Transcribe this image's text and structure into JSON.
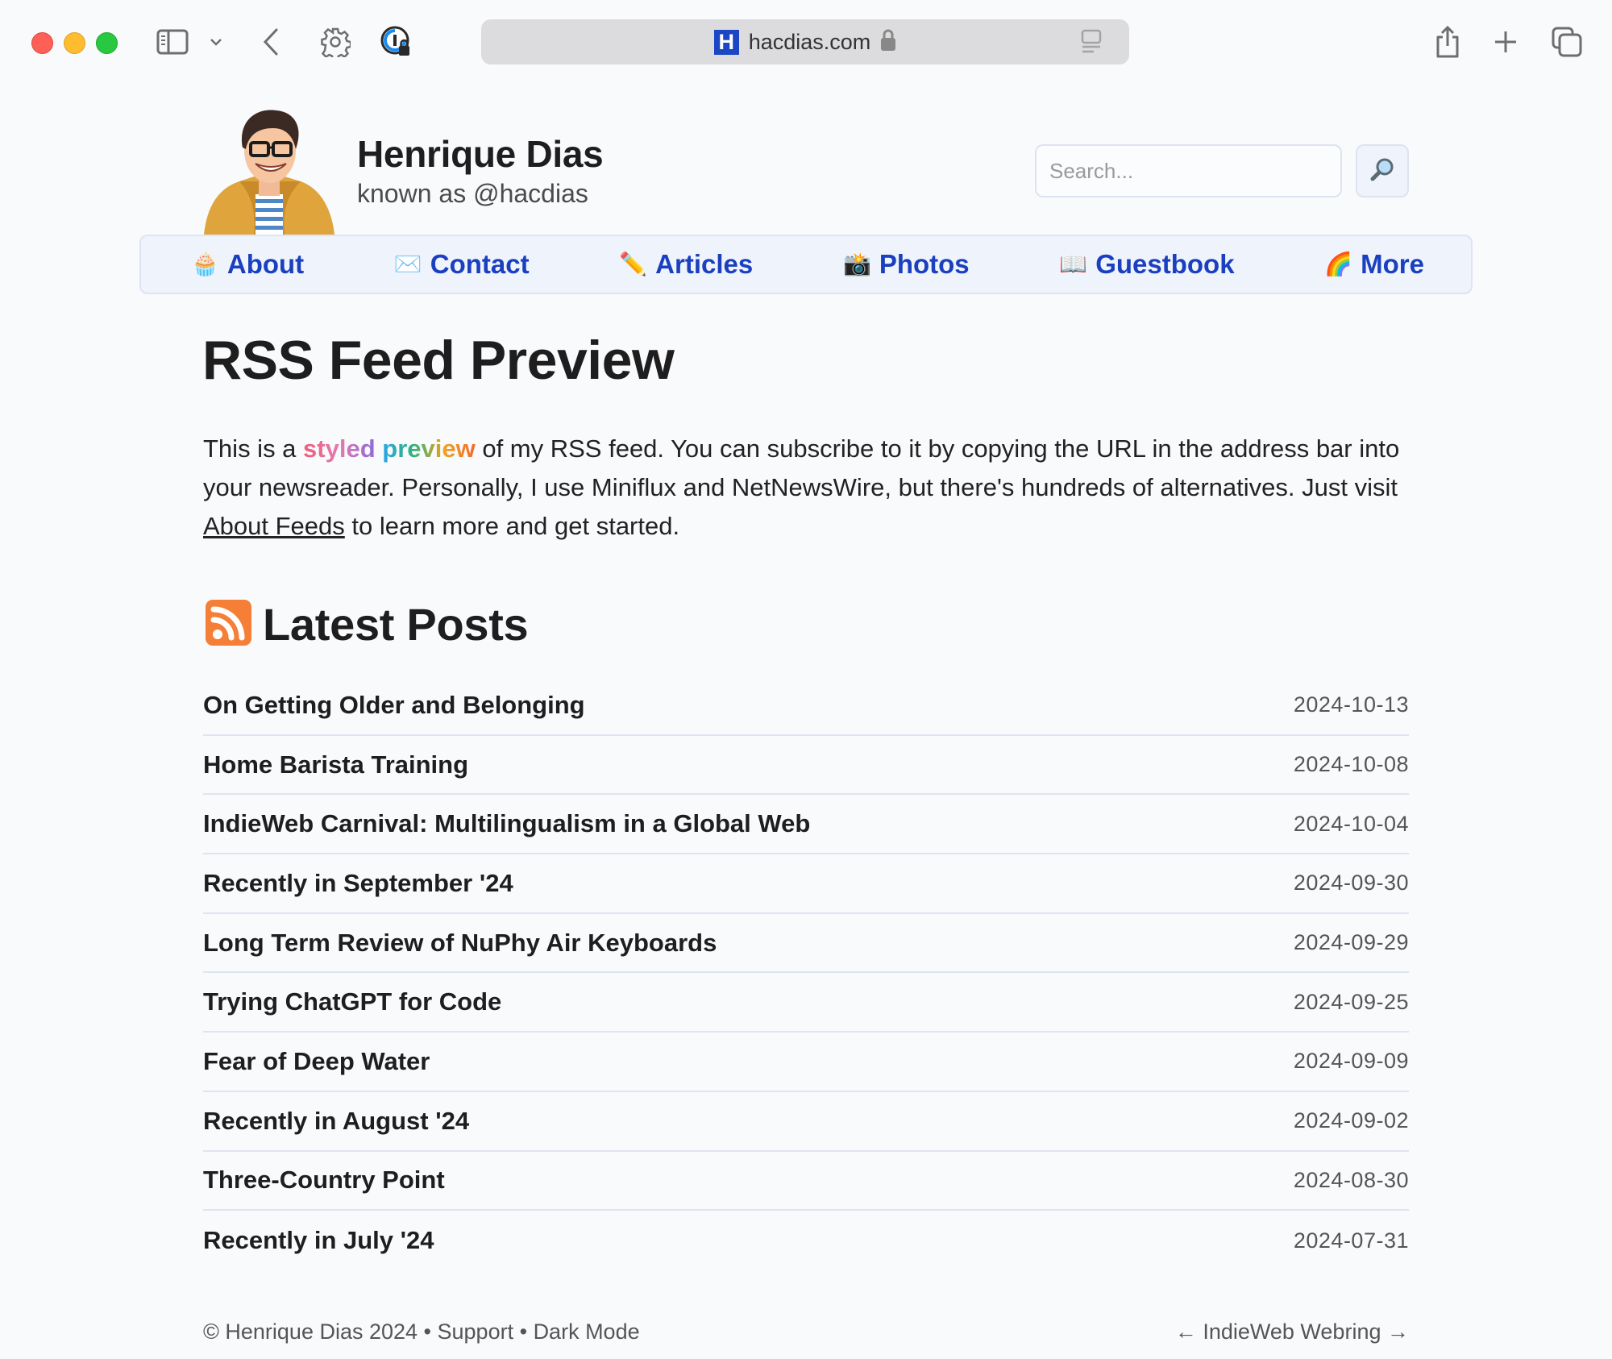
{
  "browser": {
    "url": "hacdias.com",
    "favicon_letter": "H",
    "icons": [
      "sidebar-icon",
      "chevron-down-icon",
      "back-icon",
      "gear-icon",
      "password-extension-icon",
      "share-icon",
      "new-tab-icon",
      "tabs-overview-icon"
    ]
  },
  "header": {
    "name": "Henrique Dias",
    "handle": "known as @hacdias",
    "search_placeholder": "Search...",
    "search_button_icon": "magnifier-icon"
  },
  "nav": {
    "items": [
      {
        "emoji": "🧁",
        "label": "About"
      },
      {
        "emoji": "✉️",
        "label": "Contact"
      },
      {
        "emoji": "✏️",
        "label": "Articles"
      },
      {
        "emoji": "📸",
        "label": "Photos"
      },
      {
        "emoji": "📖",
        "label": "Guestbook"
      },
      {
        "emoji": "🌈",
        "label": "More"
      }
    ]
  },
  "main": {
    "title": "RSS Feed Preview",
    "intro": {
      "prefix": "This is a ",
      "styled_word1": "styled",
      "space": " ",
      "styled_word2": "preview",
      "middle": " of my RSS feed. You can subscribe to it by copying the URL in the address bar into your newsreader. Personally, I use Miniflux and NetNewsWire, but there's hundreds of alternatives. Just visit ",
      "link_text": "About Feeds",
      "suffix": " to learn more and get started."
    },
    "latest_heading": "Latest Posts",
    "posts": [
      {
        "title": "On Getting Older and Belonging",
        "date": "2024-10-13"
      },
      {
        "title": "Home Barista Training",
        "date": "2024-10-08"
      },
      {
        "title": "IndieWeb Carnival: Multilingualism in a Global Web",
        "date": "2024-10-04"
      },
      {
        "title": "Recently in September '24",
        "date": "2024-09-30"
      },
      {
        "title": "Long Term Review of NuPhy Air Keyboards",
        "date": "2024-09-29"
      },
      {
        "title": "Trying ChatGPT for Code",
        "date": "2024-09-25"
      },
      {
        "title": "Fear of Deep Water",
        "date": "2024-09-09"
      },
      {
        "title": "Recently in August '24",
        "date": "2024-09-02"
      },
      {
        "title": "Three-Country Point",
        "date": "2024-08-30"
      },
      {
        "title": "Recently in July '24",
        "date": "2024-07-31"
      }
    ]
  },
  "footer": {
    "copyright": "© Henrique Dias 2024",
    "separator": " • ",
    "support": "Support",
    "dark_mode": "Dark Mode",
    "webring_prev": "←",
    "webring_label": "IndieWeb Webring",
    "webring_next": "→"
  },
  "colors": {
    "nav_link": "#1a3fbf",
    "nav_bg": "#eef3fc",
    "rss_orange": "#f57f36",
    "page_bg": "#f9fafc"
  }
}
